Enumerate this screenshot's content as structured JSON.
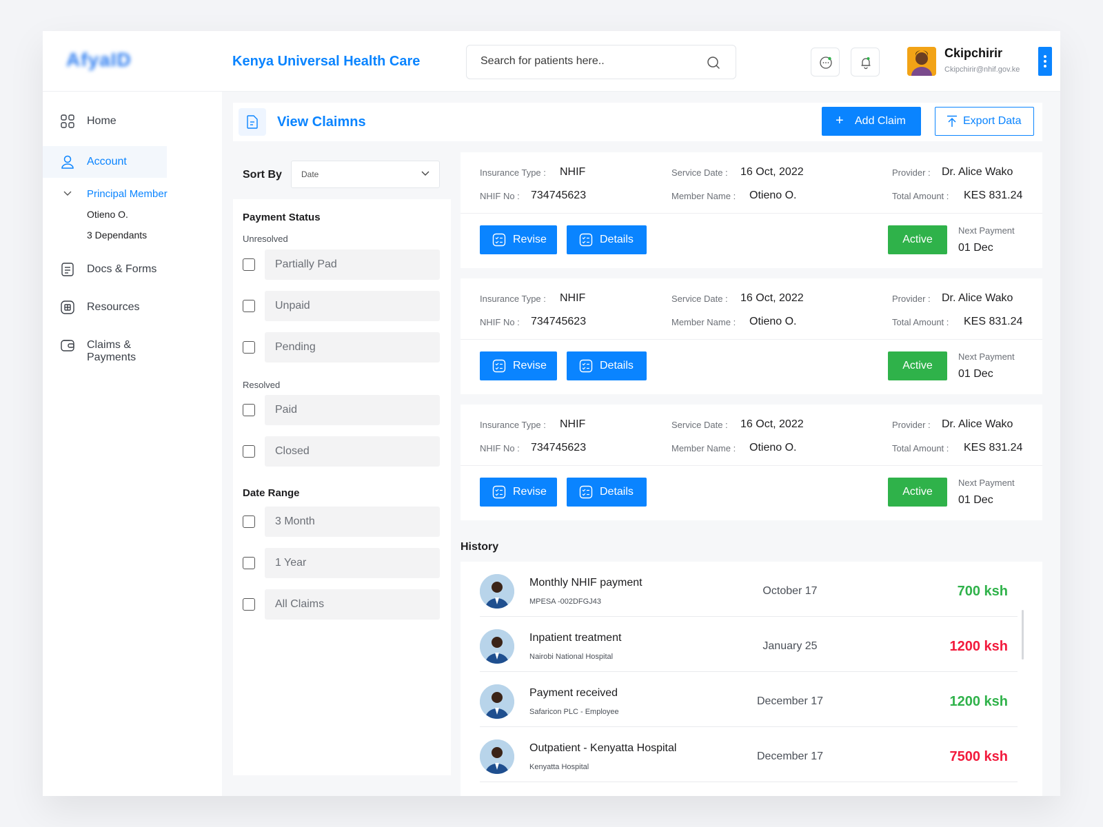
{
  "brand": {
    "logo_text": "AfyaID",
    "app_title": "Kenya Universal Health Care"
  },
  "search": {
    "placeholder": "Search for patients here.."
  },
  "user": {
    "name": "Ckipchirir",
    "email": "Ckipchirir@nhif.gov.ke"
  },
  "colors": {
    "primary": "#0a84ff",
    "success": "#2fb24a",
    "danger": "#f21a3c"
  },
  "sidebar": {
    "items": [
      {
        "label": "Home",
        "icon": "grid-icon"
      },
      {
        "label": "Account",
        "icon": "user-icon",
        "active": true
      },
      {
        "label": "Docs & Forms",
        "icon": "document-icon"
      },
      {
        "label": "Resources",
        "icon": "resources-icon"
      },
      {
        "label": "Claims & Payments",
        "icon": "wallet-icon"
      }
    ],
    "account_sub": {
      "heading": "Principal Member",
      "member": "Otieno O.",
      "dependants": "3 Dependants"
    }
  },
  "page": {
    "title": "View Claimns",
    "add_label": "Add Claim",
    "export_label": "Export Data"
  },
  "filters": {
    "sort_label": "Sort By",
    "sort_value": "Date",
    "payment_status": "Payment Status",
    "unresolved": "Unresolved",
    "unresolved_options": [
      "Partially Pad",
      "Unpaid",
      "Pending"
    ],
    "resolved": "Resolved",
    "resolved_options": [
      "Paid",
      "Closed"
    ],
    "date_range": "Date Range",
    "date_options": [
      "3 Month",
      "1 Year",
      "All Claims"
    ]
  },
  "claim_labels": {
    "insurance_type": "Insurance Type :",
    "nhif_no": "NHIF No :",
    "service_date": "Service Date :",
    "member_name": "Member Name :",
    "provider": "Provider :",
    "total_amount": "Total Amount :",
    "revise": "Revise",
    "details": "Details",
    "next_payment": "Next Payment"
  },
  "claims": [
    {
      "insurance_type": "NHIF",
      "nhif_no": "734745623",
      "service_date": "16 Oct, 2022",
      "member_name": "Otieno O.",
      "provider": "Dr. Alice Wako",
      "total_amount": "KES 831.24",
      "status": "Active",
      "next_payment": "01 Dec"
    },
    {
      "insurance_type": "NHIF",
      "nhif_no": "734745623",
      "service_date": "16 Oct, 2022",
      "member_name": "Otieno O.",
      "provider": "Dr. Alice Wako",
      "total_amount": "KES 831.24",
      "status": "Active",
      "next_payment": "01 Dec"
    },
    {
      "insurance_type": "NHIF",
      "nhif_no": "734745623",
      "service_date": "16 Oct, 2022",
      "member_name": "Otieno O.",
      "provider": "Dr. Alice Wako",
      "total_amount": "KES 831.24",
      "status": "Active",
      "next_payment": "01 Dec"
    }
  ],
  "history": {
    "title": "History",
    "rows": [
      {
        "title": "Monthly NHIF payment",
        "sub": "MPESA -002DFGJ43",
        "date": "October 17",
        "amount": "700 ksh",
        "type": "pos"
      },
      {
        "title": "Inpatient treatment",
        "sub": "Nairobi National Hospital",
        "date": "January 25",
        "amount": "1200 ksh",
        "type": "neg"
      },
      {
        "title": "Payment received",
        "sub": "Safaricon PLC - Employee",
        "date": "December 17",
        "amount": "1200 ksh",
        "type": "pos"
      },
      {
        "title": "Outpatient - Kenyatta Hospital",
        "sub": "Kenyatta Hospital",
        "date": "December 17",
        "amount": "7500 ksh",
        "type": "neg"
      }
    ]
  }
}
